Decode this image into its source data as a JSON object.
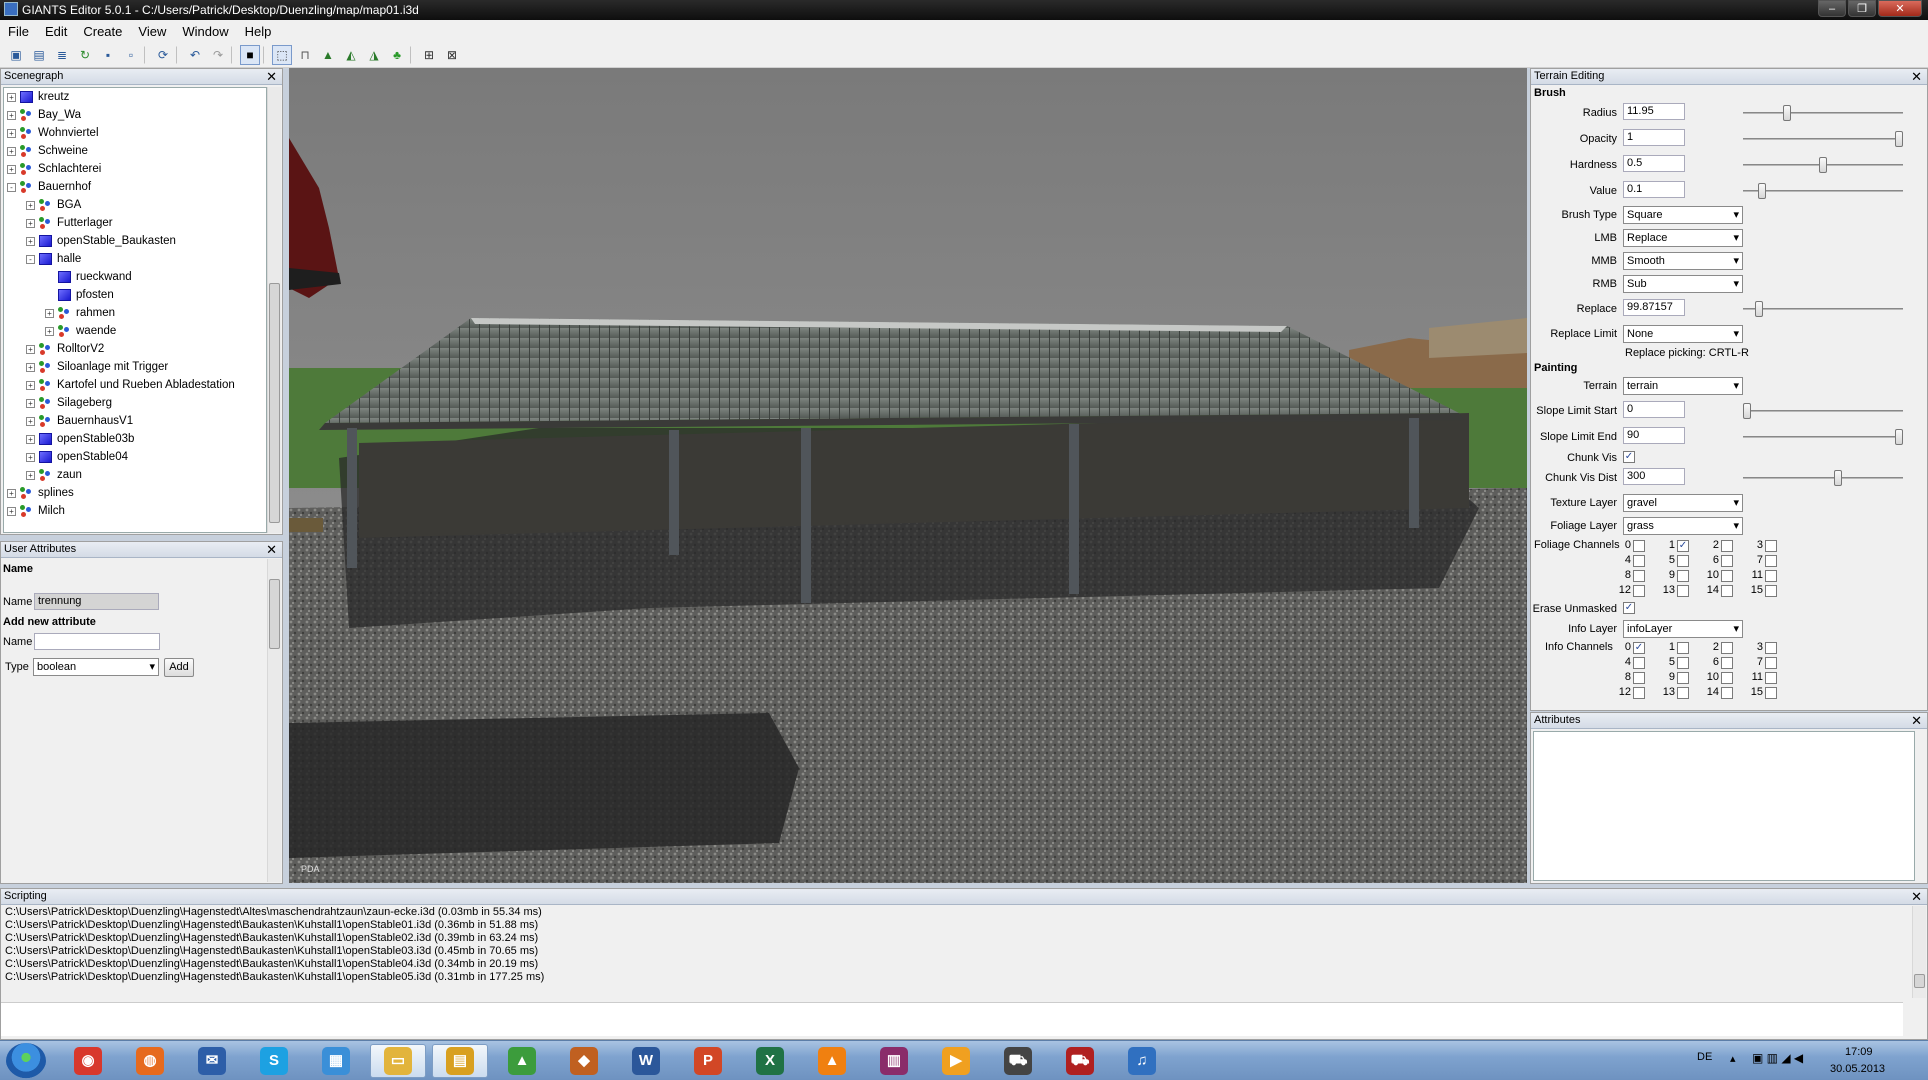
{
  "window": {
    "title": "GIANTS Editor 5.0.1 - C:/Users/Patrick/Desktop/Duenzling/map/map01.i3d"
  },
  "menu": [
    "File",
    "Edit",
    "Create",
    "View",
    "Window",
    "Help"
  ],
  "toolbar_icons": [
    "new-icon",
    "open-icon",
    "properties-icon",
    "reload-icon",
    "save-icon",
    "save-as-icon",
    "refresh-icon",
    "undo-icon",
    "redo-icon",
    "stop-icon",
    "select-icon",
    "move-icon",
    "terrain-raise-icon",
    "terrain-paint-icon",
    "terrain-smooth-icon",
    "foliage-icon",
    "snap-icon",
    "grid-icon"
  ],
  "scenegraph": {
    "title": "Scenegraph",
    "nodes": [
      {
        "label": "kreutz",
        "level": 0,
        "expander": "+",
        "icon": "cube"
      },
      {
        "label": "Bay_Wa",
        "level": 0,
        "expander": "+",
        "icon": "group"
      },
      {
        "label": "Wohnviertel",
        "level": 0,
        "expander": "+",
        "icon": "group"
      },
      {
        "label": "Schweine",
        "level": 0,
        "expander": "+",
        "icon": "group"
      },
      {
        "label": "Schlachterei",
        "level": 0,
        "expander": "+",
        "icon": "group"
      },
      {
        "label": "Bauernhof",
        "level": 0,
        "expander": "-",
        "icon": "group"
      },
      {
        "label": "BGA",
        "level": 1,
        "expander": "+",
        "icon": "group"
      },
      {
        "label": "Futterlager",
        "level": 1,
        "expander": "+",
        "icon": "group"
      },
      {
        "label": "openStable_Baukasten",
        "level": 1,
        "expander": "+",
        "icon": "cube"
      },
      {
        "label": "halle",
        "level": 1,
        "expander": "-",
        "icon": "cube"
      },
      {
        "label": "rueckwand",
        "level": 2,
        "expander": "",
        "icon": "cube"
      },
      {
        "label": "pfosten",
        "level": 2,
        "expander": "",
        "icon": "cube"
      },
      {
        "label": "rahmen",
        "level": 2,
        "expander": "+",
        "icon": "group"
      },
      {
        "label": "waende",
        "level": 2,
        "expander": "+",
        "icon": "group"
      },
      {
        "label": "RolltorV2",
        "level": 1,
        "expander": "+",
        "icon": "group"
      },
      {
        "label": "Siloanlage mit Trigger",
        "level": 1,
        "expander": "+",
        "icon": "group"
      },
      {
        "label": "Kartofel und Rueben Abladestation",
        "level": 1,
        "expander": "+",
        "icon": "group"
      },
      {
        "label": "Silageberg",
        "level": 1,
        "expander": "+",
        "icon": "group"
      },
      {
        "label": "BauernhausV1",
        "level": 1,
        "expander": "+",
        "icon": "group"
      },
      {
        "label": "openStable03b",
        "level": 1,
        "expander": "+",
        "icon": "cube"
      },
      {
        "label": "openStable04",
        "level": 1,
        "expander": "+",
        "icon": "cube"
      },
      {
        "label": "zaun",
        "level": 1,
        "expander": "+",
        "icon": "group"
      },
      {
        "label": "splines",
        "level": 0,
        "expander": "+",
        "icon": "group"
      },
      {
        "label": "Milch",
        "level": 0,
        "expander": "+",
        "icon": "group"
      }
    ]
  },
  "user_attributes": {
    "title": "User Attributes",
    "name_header": "Name",
    "name_label": "Name",
    "name_value": "trennung",
    "add_header": "Add new attribute",
    "new_name_label": "Name",
    "new_name_value": "",
    "type_label": "Type",
    "type_value": "boolean",
    "add_button": "Add"
  },
  "terrain_editing": {
    "title": "Terrain Editing",
    "brush_header": "Brush",
    "radius_label": "Radius",
    "radius_value": "11.95",
    "radius_slider": 0.26,
    "opacity_label": "Opacity",
    "opacity_value": "1",
    "opacity_slider": 1.0,
    "hardness_label": "Hardness",
    "hardness_value": "0.5",
    "hardness_slider": 0.5,
    "value_label": "Value",
    "value_value": "0.1",
    "value_slider": 0.1,
    "brush_type_label": "Brush Type",
    "brush_type_value": "Square",
    "lmb_label": "LMB",
    "lmb_value": "Replace",
    "mmb_label": "MMB",
    "mmb_value": "Smooth",
    "rmb_label": "RMB",
    "rmb_value": "Sub",
    "replace_label": "Replace",
    "replace_value": "99.87157",
    "replace_slider": 0.08,
    "replace_limit_label": "Replace Limit",
    "replace_limit_value": "None",
    "replace_picking": "Replace picking: CRTL-R",
    "painting_header": "Painting",
    "terrain_label": "Terrain",
    "terrain_value": "terrain",
    "slope_start_label": "Slope Limit Start",
    "slope_start_value": "0",
    "slope_start_slider": 0.0,
    "slope_end_label": "Slope Limit End",
    "slope_end_value": "90",
    "slope_end_slider": 1.0,
    "chunk_vis_label": "Chunk Vis",
    "chunk_vis_checked": true,
    "chunk_vis_dist_label": "Chunk Vis Dist",
    "chunk_vis_dist_value": "300",
    "chunk_vis_dist_slider": 0.6,
    "texture_layer_label": "Texture Layer",
    "texture_layer_value": "gravel",
    "foliage_layer_label": "Foliage Layer",
    "foliage_layer_value": "grass",
    "foliage_channels_label": "Foliage Channels",
    "foliage_channels": [
      "0",
      "1",
      "2",
      "3",
      "4",
      "5",
      "6",
      "7",
      "8",
      "9",
      "10",
      "11",
      "12",
      "13",
      "14",
      "15"
    ],
    "foliage_checked": [
      1
    ],
    "erase_unmasked_label": "Erase Unmasked",
    "erase_unmasked_checked": true,
    "info_layer_label": "Info Layer",
    "info_layer_value": "infoLayer",
    "info_channels_label": "Info Channels",
    "info_channels": [
      "0",
      "1",
      "2",
      "3",
      "4",
      "5",
      "6",
      "7",
      "8",
      "9",
      "10",
      "11",
      "12",
      "13",
      "14",
      "15"
    ],
    "info_checked": [
      0
    ]
  },
  "attributes": {
    "title": "Attributes"
  },
  "scripting": {
    "title": "Scripting",
    "log": [
      "C:\\Users\\Patrick\\Desktop\\Duenzling\\Hagenstedt\\Altes\\maschendrahtzaun\\zaun-ecke.i3d (0.03mb in 55.34 ms)",
      "C:\\Users\\Patrick\\Desktop\\Duenzling\\Hagenstedt\\Baukasten\\Kuhstall1\\openStable01.i3d (0.36mb in 51.88 ms)",
      "C:\\Users\\Patrick\\Desktop\\Duenzling\\Hagenstedt\\Baukasten\\Kuhstall1\\openStable02.i3d (0.39mb in 63.24 ms)",
      "C:\\Users\\Patrick\\Desktop\\Duenzling\\Hagenstedt\\Baukasten\\Kuhstall1\\openStable03.i3d (0.45mb in 70.65 ms)",
      "C:\\Users\\Patrick\\Desktop\\Duenzling\\Hagenstedt\\Baukasten\\Kuhstall1\\openStable04.i3d (0.34mb in 20.19 ms)",
      "C:\\Users\\Patrick\\Desktop\\Duenzling\\Hagenstedt\\Baukasten\\Kuhstall1\\openStable05.i3d (0.31mb in 177.25 ms)"
    ]
  },
  "viewport": {
    "corner_label": "PDA"
  },
  "taskbar": {
    "apps": [
      {
        "name": "chrome-icon",
        "color": "#d8382c",
        "glyph": "◉"
      },
      {
        "name": "firefox-icon",
        "color": "#e66a1e",
        "glyph": "◍"
      },
      {
        "name": "thunderbird-icon",
        "color": "#2d5ea8",
        "glyph": "✉"
      },
      {
        "name": "skype-icon",
        "color": "#1da1e2",
        "glyph": "S"
      },
      {
        "name": "media-icon",
        "color": "#3a8fd8",
        "glyph": "▦"
      },
      {
        "name": "explorer-icon",
        "color": "#e2b43c",
        "glyph": "▭"
      },
      {
        "name": "giants-editor-icon",
        "color": "#d8a020",
        "glyph": "▤"
      },
      {
        "name": "chart-app-icon",
        "color": "#3c9c3c",
        "glyph": "▲"
      },
      {
        "name": "installer-icon",
        "color": "#c06020",
        "glyph": "◆"
      },
      {
        "name": "word-icon",
        "color": "#2b579a",
        "glyph": "W"
      },
      {
        "name": "powerpoint-icon",
        "color": "#d24726",
        "glyph": "P"
      },
      {
        "name": "excel-icon",
        "color": "#207245",
        "glyph": "X"
      },
      {
        "name": "vlc-icon",
        "color": "#f08010",
        "glyph": "▲"
      },
      {
        "name": "winrar-icon",
        "color": "#8a2c6a",
        "glyph": "▥"
      },
      {
        "name": "video-player-icon",
        "color": "#f0a020",
        "glyph": "▶"
      },
      {
        "name": "tractor-icon",
        "color": "#444",
        "glyph": "⛟"
      },
      {
        "name": "farming-simulator-icon",
        "color": "#b02020",
        "glyph": "⛟"
      },
      {
        "name": "itunes-icon",
        "color": "#3070c0",
        "glyph": "♫"
      }
    ],
    "language": "DE",
    "time": "17:09",
    "date": "30.05.2013"
  }
}
